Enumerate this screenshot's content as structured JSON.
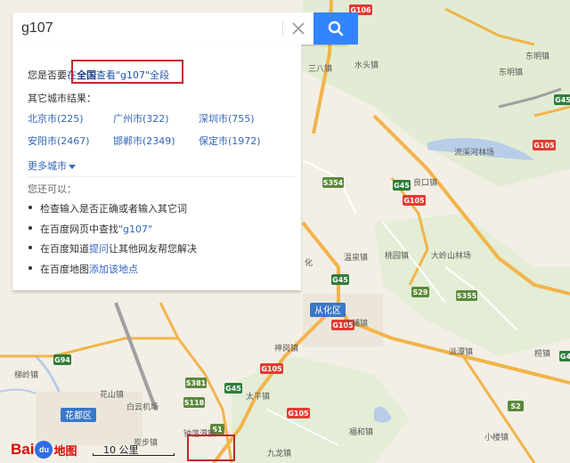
{
  "search": {
    "query": "g107",
    "placeholder": ""
  },
  "panel": {
    "prefix": "您是否要",
    "link_pre": "在",
    "link_bold": "全国",
    "link_mid": "查看",
    "link_quote": "\"g107\"",
    "link_post": "全段",
    "other_title": "其它城市结果：",
    "cities": [
      {
        "label": "北京市(225)"
      },
      {
        "label": "广州市(322)"
      },
      {
        "label": "深圳市(755)"
      },
      {
        "label": "安阳市(2467)"
      },
      {
        "label": "邯郸市(2349)"
      },
      {
        "label": "保定市(1972)"
      }
    ],
    "more_cities": "更多城市",
    "also_title": "您还可以：",
    "tips": [
      {
        "text": "检查输入是否正确或者输入其它词"
      },
      {
        "pre": "在百度网页中查找",
        "link": "\"g107\""
      },
      {
        "pre": "在百度知道",
        "link": "提问",
        "post": "让其他网友帮您解决"
      },
      {
        "pre": "在百度地图",
        "link": "添加该地点"
      }
    ]
  },
  "map": {
    "places": [
      "三八镇",
      "水头镇",
      "东明镇",
      "东明镇",
      "良口镇",
      "流溪河林场",
      "温泉镇",
      "桃园镇",
      "大岭山林场",
      "从化区",
      "江埔镇",
      "神岗镇",
      "派潭镇",
      "太平镇",
      "花山镇",
      "白云机场",
      "钟落潭镇",
      "福和镇",
      "九龙镇",
      "小楼镇",
      "花都区",
      "炭步镇",
      "榄镇",
      "化",
      "梯岭镇"
    ],
    "highways": [
      "G106",
      "G105",
      "G45",
      "S354",
      "G105",
      "S29",
      "S355",
      "G105",
      "G94",
      "S381",
      "G45",
      "G105",
      "S118",
      "G105",
      "S2",
      "G4",
      "G45",
      "G45",
      "S1"
    ]
  },
  "logo": {
    "bai": "Bai",
    "du": "du",
    "ditu": "地图"
  },
  "scale": {
    "label": "10 公里"
  },
  "colors": {
    "search_button": "#3385ff",
    "highway": "#2f7d3b",
    "provincial": "#5a8a3a",
    "red": "#e03c31",
    "road": "#f2b44a",
    "water": "#b7cde8"
  }
}
